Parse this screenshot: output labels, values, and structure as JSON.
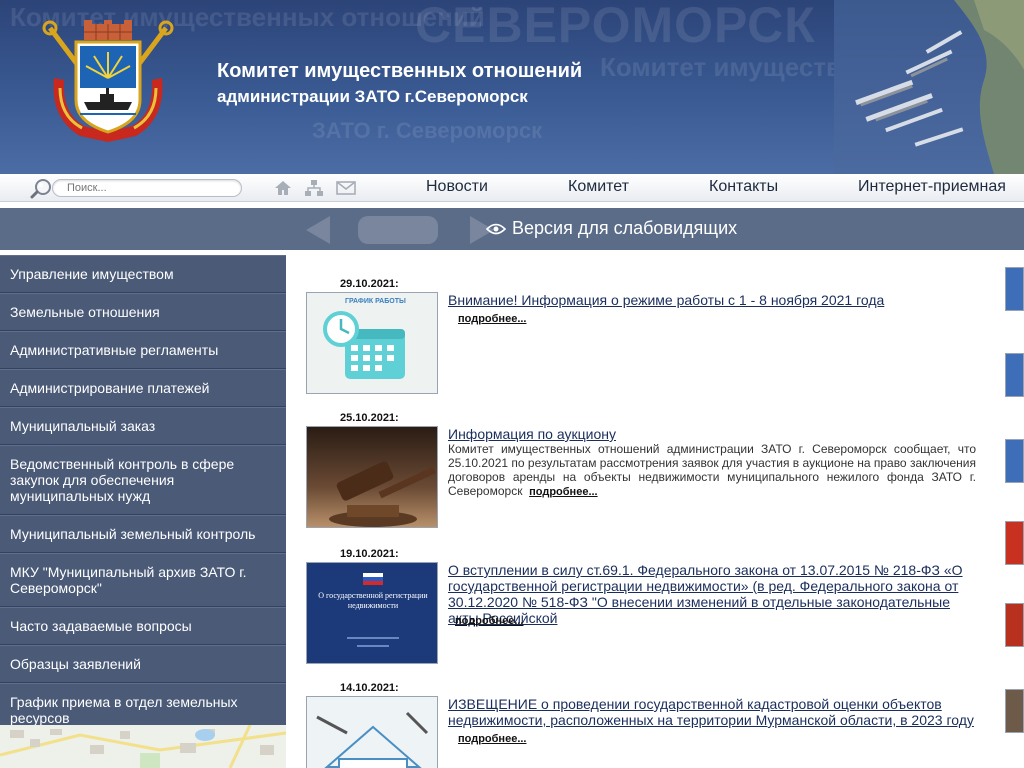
{
  "header": {
    "title_line1": "Комитет имущественных отношений",
    "title_line2": "администрации ЗАТО г.Североморск",
    "bg_word_big": "СЕВЕРОМОРСК",
    "bg_word_mid": "Комитет имущественных отношений",
    "bg_word_small": "ЗАТО г. Североморск",
    "bg_word_topleft": "Комитет имущественных отношений",
    "emblem_icon": "coat-of-arms-icon"
  },
  "search": {
    "placeholder": "Поиск..."
  },
  "nav": {
    "icons": [
      "home-icon",
      "sitemap-icon",
      "mail-icon"
    ],
    "links": [
      "Новости",
      "Комитет",
      "Контакты",
      "Интернет-приемная"
    ]
  },
  "accessibility": {
    "label": "Версия для слабовидящих"
  },
  "sidebar": {
    "items": [
      "Управление имуществом",
      "Земельные отношения",
      "Административные регламенты",
      "Администрирование платежей",
      "Муниципальный заказ",
      "Ведомственный контроль в сфере закупок для обеспечения муниципальных нужд",
      "Муниципальный земельный контроль",
      "МКУ \"Муниципальный архив ЗАТО г. Североморск\"",
      "Часто задаваемые вопросы",
      "Образцы заявлений",
      "График приема в отдел земельных ресурсов"
    ]
  },
  "news": {
    "more_label": "подробнее...",
    "items": [
      {
        "date": "29.10.2021:",
        "title": "Внимание! Информация о режиме работы с 1 - 8 ноября 2021 года",
        "body": "",
        "thumb_caption": "ГРАФИК РАБОТЫ"
      },
      {
        "date": "25.10.2021:",
        "title": "Информация по аукциону",
        "body": "Комитет имущественных отношений администрации ЗАТО г. Североморск сообщает, что 25.10.2021 по результатам рассмотрения заявок для участия в аукционе на право заключения договоров аренды на объекты недвижимости муниципального нежилого фонда ЗАТО г. Североморск",
        "thumb_caption": ""
      },
      {
        "date": "19.10.2021:",
        "title": "О вступлении в силу ст.69.1. Федерального закона от 13.07.2015 № 218-ФЗ «О государственной регистрации недвижимости» (в ред. Федерального закона от 30.12.2020 № 518-ФЗ \"О внесении изменений в отдельные законодательные акты Российской",
        "body": "",
        "thumb_caption": "О государственной регистрации недвижимости"
      },
      {
        "date": "14.10.2021:",
        "title": "ИЗВЕЩЕНИЕ о проведении государственной кадастровой оценки объектов недвижимости, расположенных на территории Мурманской области, в 2023 году",
        "body": "",
        "thumb_caption": ""
      }
    ]
  },
  "colors": {
    "header_bg": "#34508a",
    "sidebar_bg": "#4a5a77",
    "access_bar_bg": "#5b6c88",
    "link": "#1a2e5c"
  }
}
